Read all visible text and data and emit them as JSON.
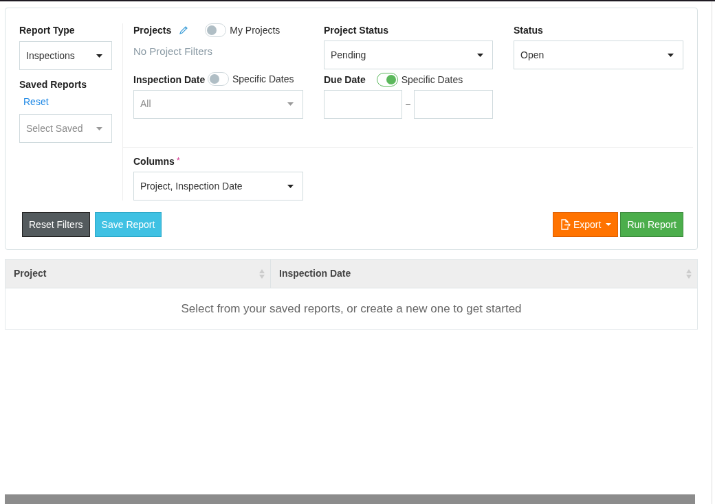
{
  "report_type": {
    "label": "Report Type",
    "value": "Inspections"
  },
  "saved_reports": {
    "label": "Saved Reports",
    "reset_link": "Reset",
    "placeholder": "Select Saved"
  },
  "projects": {
    "label": "Projects",
    "toggle": {
      "label": "My Projects",
      "on": false
    },
    "empty_text": "No Project Filters"
  },
  "inspection_date": {
    "label": "Inspection Date",
    "toggle": {
      "label": "Specific Dates",
      "on": false
    },
    "placeholder": "All"
  },
  "project_status": {
    "label": "Project Status",
    "value": "Pending"
  },
  "due_date": {
    "label": "Due Date",
    "toggle": {
      "label": "Specific Dates",
      "on": true
    },
    "separator": "–"
  },
  "status": {
    "label": "Status",
    "value": "Open"
  },
  "columns": {
    "label": "Columns",
    "required_mark": "*",
    "value": "Project, Inspection Date"
  },
  "buttons_left": [
    {
      "kind": "dark",
      "label": "Reset Filters"
    },
    {
      "kind": "info",
      "label": "Save Report"
    }
  ],
  "buttons_right": [
    {
      "kind": "export",
      "label": "Export"
    },
    {
      "kind": "success",
      "label": "Run Report"
    }
  ],
  "table": {
    "columns": [
      {
        "label": "Project"
      },
      {
        "label": "Inspection Date"
      }
    ],
    "empty_text": "Select from your saved reports, or create a new one to get started"
  }
}
